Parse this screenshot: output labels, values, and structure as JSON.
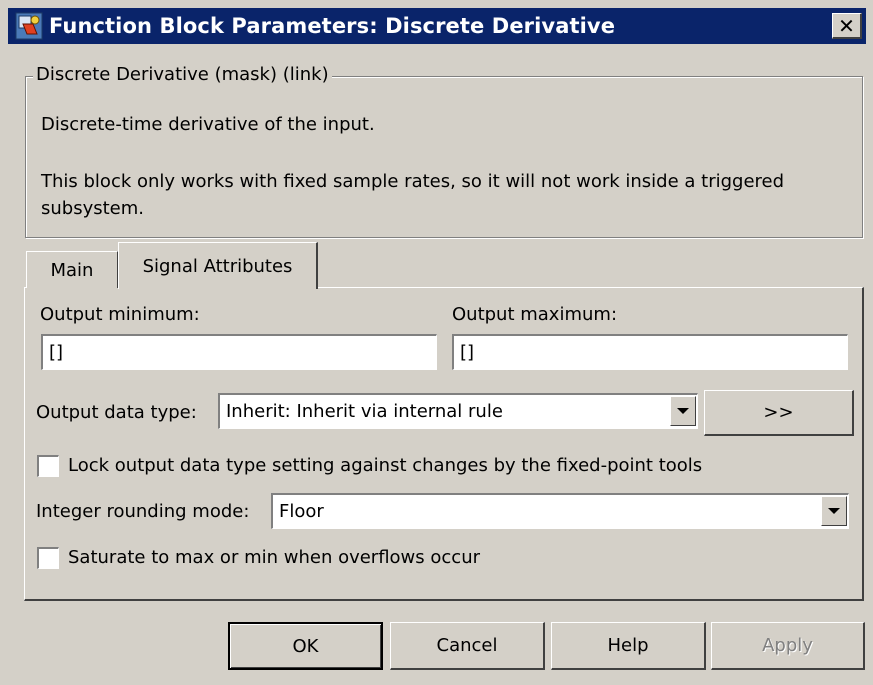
{
  "window": {
    "title": "Function Block Parameters: Discrete Derivative",
    "icon": "simulink-block-icon",
    "close_symbol": "✕"
  },
  "group": {
    "label": "Discrete Derivative (mask) (link)",
    "description1": "Discrete-time derivative of the input.",
    "description2": "This block only works with fixed sample rates, so it will not work inside a triggered subsystem."
  },
  "tabs": [
    {
      "label": "Main",
      "selected": false
    },
    {
      "label": "Signal Attributes",
      "selected": true
    }
  ],
  "panel": {
    "output_min": {
      "label": "Output minimum:",
      "value": "[]"
    },
    "output_max": {
      "label": "Output maximum:",
      "value": "[]"
    },
    "output_type": {
      "label": "Output data type:",
      "value": "Inherit: Inherit via internal rule",
      "assistant_label": ">>"
    },
    "lock_checkbox": {
      "label": "Lock output data type setting against changes by the fixed-point tools",
      "checked": false
    },
    "rounding": {
      "label": "Integer rounding mode:",
      "value": "Floor"
    },
    "saturate_checkbox": {
      "label": "Saturate to max or min when overflows occur",
      "checked": false
    }
  },
  "buttons": {
    "ok": "OK",
    "cancel": "Cancel",
    "help": "Help",
    "apply": "Apply"
  }
}
